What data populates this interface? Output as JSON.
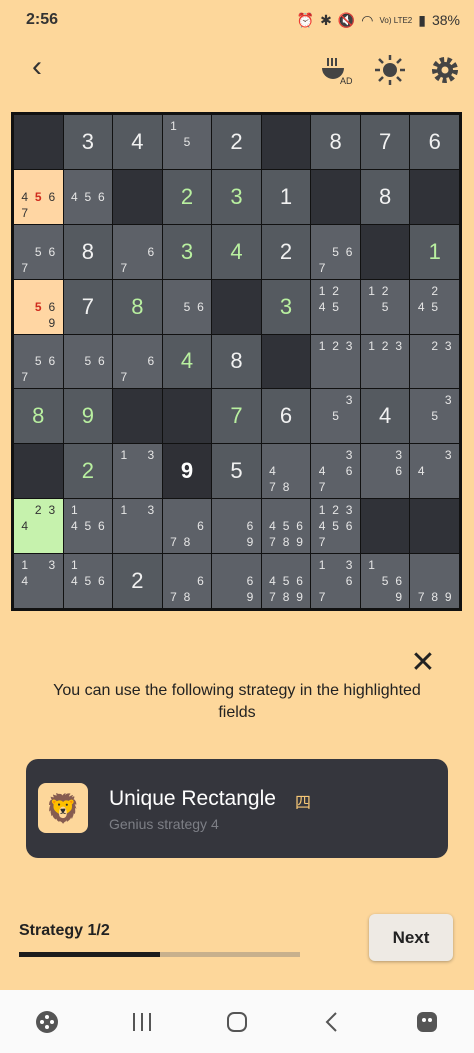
{
  "status_bar": {
    "time": "2:56",
    "network": "Vo) LTE2",
    "battery": "38%"
  },
  "toolbar": {
    "back_icon": "back-icon",
    "ad_label": "AD",
    "brightness_icon": "brightness-icon",
    "settings_icon": "gear-icon"
  },
  "board": [
    [
      {
        "v": "",
        "t": "dark"
      },
      {
        "v": "3",
        "t": "given"
      },
      {
        "v": "4",
        "t": "given"
      },
      {
        "c": [
          "1",
          "",
          "",
          "",
          "5",
          "",
          "",
          "",
          ""
        ],
        "t": "light"
      },
      {
        "v": "2",
        "t": "given"
      },
      {
        "v": "",
        "t": "dark"
      },
      {
        "v": "8",
        "t": "given"
      },
      {
        "v": "7",
        "t": "given"
      },
      {
        "v": "6",
        "t": "given"
      }
    ],
    [
      {
        "c": [
          "",
          "",
          "",
          "4",
          "5r",
          "6",
          "7",
          "",
          ""
        ],
        "t": "hl-orange"
      },
      {
        "c": [
          "",
          "",
          "",
          "4",
          "5",
          "6",
          "",
          "",
          ""
        ],
        "t": "light"
      },
      {
        "v": "",
        "t": "dark"
      },
      {
        "v": "2",
        "t": "placed"
      },
      {
        "v": "3",
        "t": "placed"
      },
      {
        "v": "1",
        "t": "given"
      },
      {
        "v": "",
        "t": "dark"
      },
      {
        "v": "8",
        "t": "given"
      },
      {
        "v": "",
        "t": "dark"
      }
    ],
    [
      {
        "c": [
          "",
          "",
          "",
          "",
          "5",
          "6",
          "7",
          "",
          ""
        ],
        "t": "light"
      },
      {
        "v": "8",
        "t": "given"
      },
      {
        "c": [
          "",
          "",
          "",
          "",
          "",
          "6",
          "7",
          "",
          ""
        ],
        "t": "light"
      },
      {
        "v": "3",
        "t": "placed"
      },
      {
        "v": "4",
        "t": "placed"
      },
      {
        "v": "2",
        "t": "given"
      },
      {
        "c": [
          "",
          "",
          "",
          "",
          "5",
          "6",
          "7",
          "",
          ""
        ],
        "t": "light"
      },
      {
        "v": "",
        "t": "dark"
      },
      {
        "v": "1",
        "t": "placed"
      }
    ],
    [
      {
        "c": [
          "",
          "",
          "",
          "",
          "5r",
          "6",
          "",
          "",
          "9"
        ],
        "t": "hl-orange"
      },
      {
        "v": "7",
        "t": "given"
      },
      {
        "v": "8",
        "t": "placed"
      },
      {
        "c": [
          "",
          "",
          "",
          "",
          "5",
          "6",
          "",
          "",
          ""
        ],
        "t": "light"
      },
      {
        "v": "",
        "t": "dark"
      },
      {
        "v": "3",
        "t": "placed"
      },
      {
        "c": [
          "1",
          "2",
          "",
          "4",
          "5",
          "",
          "",
          "",
          ""
        ],
        "t": "light"
      },
      {
        "c": [
          "1",
          "2",
          "",
          "",
          "5",
          "",
          "",
          "",
          ""
        ],
        "t": "light"
      },
      {
        "c": [
          "",
          "2",
          "",
          "4",
          "5",
          "",
          "",
          "",
          ""
        ],
        "t": "light"
      }
    ],
    [
      {
        "c": [
          "",
          "",
          "",
          "",
          "5",
          "6",
          "7",
          "",
          ""
        ],
        "t": "light"
      },
      {
        "c": [
          "",
          "",
          "",
          "",
          "5",
          "6",
          "",
          "",
          ""
        ],
        "t": "light"
      },
      {
        "c": [
          "",
          "",
          "",
          "",
          "",
          "6",
          "7",
          "",
          ""
        ],
        "t": "light"
      },
      {
        "v": "4",
        "t": "placed"
      },
      {
        "v": "8",
        "t": "given"
      },
      {
        "v": "",
        "t": "dark"
      },
      {
        "c": [
          "1",
          "2",
          "3",
          "",
          "",
          "",
          "",
          "",
          ""
        ],
        "t": "light"
      },
      {
        "c": [
          "1",
          "2",
          "3",
          "",
          "",
          "",
          "",
          "",
          ""
        ],
        "t": "light"
      },
      {
        "c": [
          "",
          "2",
          "3",
          "",
          "",
          "",
          "",
          "",
          ""
        ],
        "t": "light"
      }
    ],
    [
      {
        "v": "8",
        "t": "placed"
      },
      {
        "v": "9",
        "t": "placed"
      },
      {
        "v": "",
        "t": "dark"
      },
      {
        "v": "",
        "t": "dark"
      },
      {
        "v": "7",
        "t": "placed"
      },
      {
        "v": "6",
        "t": "given"
      },
      {
        "c": [
          "",
          "",
          "3",
          "",
          "5",
          "",
          "",
          "",
          ""
        ],
        "t": "light"
      },
      {
        "v": "4",
        "t": "given"
      },
      {
        "c": [
          "",
          "",
          "3",
          "",
          "5",
          "",
          "",
          "",
          ""
        ],
        "t": "light"
      }
    ],
    [
      {
        "v": "",
        "t": "dark"
      },
      {
        "v": "2",
        "t": "placed"
      },
      {
        "c": [
          "1",
          "",
          "3",
          "",
          "",
          "",
          "",
          "",
          ""
        ],
        "t": "light"
      },
      {
        "v": "9",
        "t": "bold"
      },
      {
        "v": "5",
        "t": "given"
      },
      {
        "c": [
          "",
          "",
          "",
          "4",
          "",
          "",
          "7",
          "8",
          ""
        ],
        "t": "light"
      },
      {
        "c": [
          "",
          "",
          "3",
          "4",
          "",
          "6",
          "7",
          "",
          ""
        ],
        "t": "light"
      },
      {
        "c": [
          "",
          "",
          "3",
          "",
          "",
          "6",
          "",
          "",
          ""
        ],
        "t": "light"
      },
      {
        "c": [
          "",
          "",
          "3",
          "4",
          "",
          "",
          "",
          "",
          ""
        ],
        "t": "light"
      }
    ],
    [
      {
        "c": [
          "",
          "2",
          "3",
          "4",
          "",
          "",
          "",
          "",
          ""
        ],
        "t": "hl-green"
      },
      {
        "c": [
          "1",
          "",
          "",
          "4",
          "5",
          "6",
          "",
          "",
          ""
        ],
        "t": "light"
      },
      {
        "c": [
          "1",
          "",
          "3",
          "",
          "",
          "",
          "",
          "",
          ""
        ],
        "t": "light"
      },
      {
        "c": [
          "",
          "",
          "",
          "",
          "",
          "6",
          "7",
          "8",
          ""
        ],
        "t": "light"
      },
      {
        "c": [
          "",
          "",
          "",
          "",
          "",
          "6",
          "",
          "",
          "9"
        ],
        "t": "light"
      },
      {
        "c": [
          "",
          "",
          "",
          "4",
          "5",
          "6",
          "7",
          "8",
          "9"
        ],
        "t": "light"
      },
      {
        "c": [
          "1",
          "2",
          "3",
          "4",
          "5",
          "6",
          "7",
          "",
          ""
        ],
        "t": "light"
      },
      {
        "v": "",
        "t": "dark"
      },
      {
        "v": "",
        "t": "dark"
      }
    ],
    [
      {
        "c": [
          "1",
          "",
          "3",
          "4",
          "",
          "",
          "",
          "",
          ""
        ],
        "t": "light"
      },
      {
        "c": [
          "1",
          "",
          "",
          "4",
          "5",
          "6",
          "",
          "",
          ""
        ],
        "t": "light"
      },
      {
        "v": "2",
        "t": "given"
      },
      {
        "c": [
          "",
          "",
          "",
          "",
          "",
          "6",
          "7",
          "8",
          ""
        ],
        "t": "light"
      },
      {
        "c": [
          "",
          "",
          "",
          "",
          "",
          "6",
          "",
          "",
          "9"
        ],
        "t": "light"
      },
      {
        "c": [
          "",
          "",
          "",
          "4",
          "5",
          "6",
          "7",
          "8",
          "9"
        ],
        "t": "light"
      },
      {
        "c": [
          "1",
          "",
          "3",
          "",
          "",
          "6",
          "7",
          "",
          ""
        ],
        "t": "light"
      },
      {
        "c": [
          "1",
          "",
          "",
          "",
          "5",
          "6",
          "",
          "",
          "9"
        ],
        "t": "light"
      },
      {
        "c": [
          "",
          "",
          "",
          "",
          "",
          "",
          "7",
          "8",
          "9"
        ],
        "t": "light"
      }
    ]
  ],
  "close_icon": "close-icon",
  "hint_text": "You can use the following strategy in the highlighted fields",
  "strategy_card": {
    "avatar_icon": "lion-icon",
    "name": "Unique Rectangle",
    "kanji": "四",
    "subtitle": "Genius strategy 4"
  },
  "footer": {
    "strategy_label": "Strategy 1/2",
    "progress": 0.5,
    "next_label": "Next"
  },
  "navbar": {
    "game_icon": "gamepad-icon",
    "recents_icon": "recents-icon",
    "home_icon": "home-icon",
    "back_icon": "nav-back-icon",
    "assistant_icon": "assistant-icon"
  }
}
